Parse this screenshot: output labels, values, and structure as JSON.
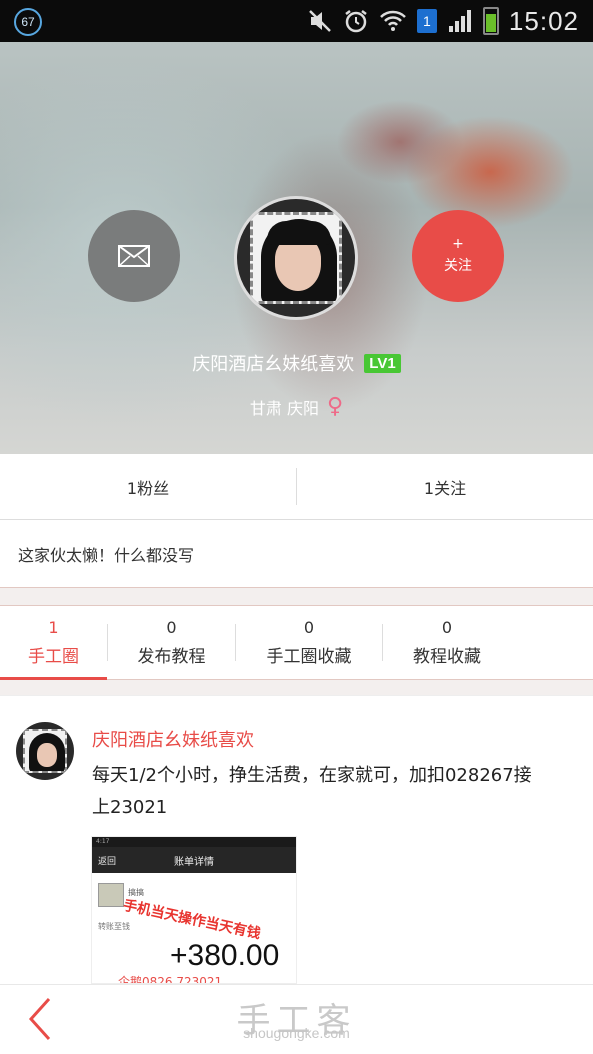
{
  "status_bar": {
    "notification_badge": "67",
    "sim_indicator": "1",
    "time": "15:02",
    "icons": [
      "mute-icon",
      "alarm-icon",
      "wifi-icon",
      "sim-icon",
      "signal-icon",
      "battery-icon"
    ]
  },
  "profile": {
    "message_icon": "mail-icon",
    "follow_plus": "+",
    "follow_label": "关注",
    "username": "庆阳酒店幺妹纸喜欢",
    "level": "LV1",
    "location": "甘肃 庆阳",
    "gender_symbol": "♀"
  },
  "stats": {
    "fans": "1粉丝",
    "following": "1关注"
  },
  "bio": "这家伙太懒！什么都没写",
  "tabs": [
    {
      "count": "1",
      "label": "手工圈",
      "active": true
    },
    {
      "count": "0",
      "label": "发布教程",
      "active": false
    },
    {
      "count": "0",
      "label": "手工圈收藏",
      "active": false
    },
    {
      "count": "0",
      "label": "教程收藏",
      "active": false
    }
  ],
  "post": {
    "author": "庆阳酒店幺妹纸喜欢",
    "text": "每天1/2个小时，挣生活费，在家就可，加扣028267接上23021",
    "image": {
      "status": "4:17",
      "back": "返回",
      "title": "账单详情",
      "small": "搞搞",
      "row": "转账至钱",
      "stamp": "手机当天操作当天有钱",
      "amount": "+380.00",
      "bottom": "企鹅0826 723021"
    }
  },
  "bottom_bar": {
    "back_icon": "chevron-left-icon",
    "watermark_title": "手工客",
    "watermark_url": "shougongke.com"
  },
  "colors": {
    "accent": "#e84c48",
    "level_badge": "#48c734",
    "female": "#ee6a88"
  }
}
